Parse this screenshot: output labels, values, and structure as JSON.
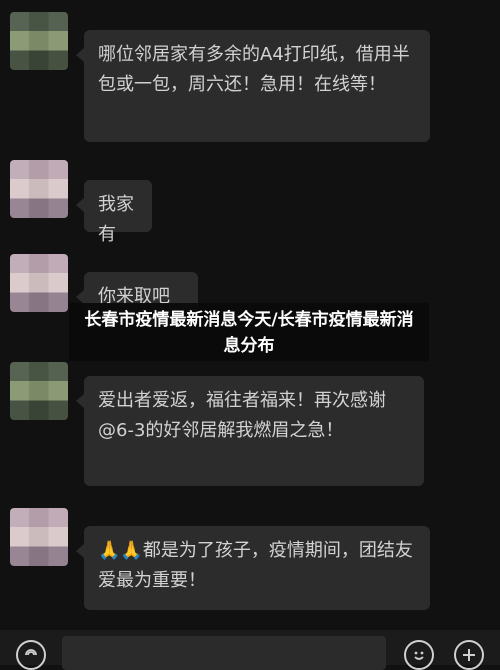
{
  "messages": [
    {
      "text": "哪位邻居家有多余的A4打印纸，借用半包或一包，周六还！急用！在线等！"
    },
    {
      "text": "我家有"
    },
    {
      "text": "你来取吧"
    },
    {
      "text": "爱出者爱返，福往者福来！再次感谢@6-3的好邻居解我燃眉之急！"
    },
    {
      "text": "🙏🙏都是为了孩子，疫情期间，团结友爱最为重要！"
    }
  ],
  "overlay": {
    "title": "长春市疫情最新消息今天/长春市疫情最新消息分布"
  },
  "input_bar": {
    "icons": [
      "voice-icon",
      "emoji-icon",
      "plus-icon"
    ]
  }
}
